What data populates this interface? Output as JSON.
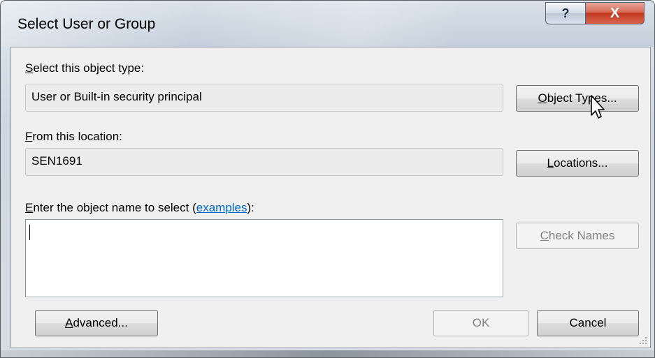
{
  "window": {
    "title": "Select User or Group",
    "help_glyph": "?",
    "close_glyph": "X"
  },
  "object_type": {
    "label_accel": "S",
    "label_rest": "elect this object type:",
    "value": "User or Built-in security principal",
    "button_accel": "O",
    "button_rest": "bject Types..."
  },
  "location": {
    "label_accel": "F",
    "label_rest": "rom this location:",
    "value": "SEN1691",
    "button_accel": "L",
    "button_rest": "ocations..."
  },
  "object_name": {
    "label_accel": "E",
    "label_before_link": "nter the object name to select (",
    "link": "examples",
    "label_after_link": "):",
    "value": "",
    "check_accel": "C",
    "check_rest": "heck Names"
  },
  "footer": {
    "advanced_accel": "A",
    "advanced_rest": "dvanced...",
    "ok_label": "OK",
    "cancel_label": "Cancel"
  },
  "icons": [
    "help-icon",
    "close-icon",
    "mouse-pointer-icon",
    "resize-grip-icon"
  ]
}
